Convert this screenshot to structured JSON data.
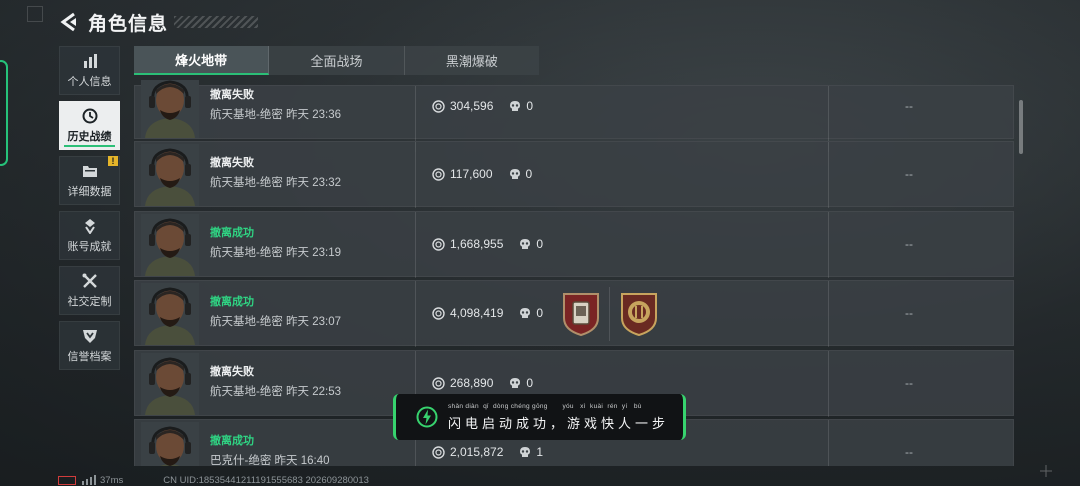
{
  "header": {
    "title": "角色信息"
  },
  "sidebar": {
    "items": [
      {
        "label": "个人信息",
        "icon": "bar-chart-icon",
        "active": false
      },
      {
        "label": "历史战绩",
        "icon": "clock-icon",
        "active": true
      },
      {
        "label": "详细数据",
        "icon": "folder-icon",
        "active": false,
        "badge": "!"
      },
      {
        "label": "账号成就",
        "icon": "medal-icon",
        "active": false
      },
      {
        "label": "社交定制",
        "icon": "tools-icon",
        "active": false
      },
      {
        "label": "信誉档案",
        "icon": "shield-icon",
        "active": false
      }
    ]
  },
  "tabs": [
    {
      "label": "烽火地带",
      "active": true
    },
    {
      "label": "全面战场",
      "active": false
    },
    {
      "label": "黑潮爆破",
      "active": false
    }
  ],
  "matches": [
    {
      "status": "撤离失败",
      "success": false,
      "detail": "航天基地-绝密 昨天 23:36",
      "money": "304,596",
      "kills": "0",
      "extra": "--",
      "medals": []
    },
    {
      "status": "撤离失败",
      "success": false,
      "detail": "航天基地-绝密 昨天 23:32",
      "money": "117,600",
      "kills": "0",
      "extra": "--",
      "medals": []
    },
    {
      "status": "撤离成功",
      "success": true,
      "detail": "航天基地-绝密 昨天 23:19",
      "money": "1,668,955",
      "kills": "0",
      "extra": "--",
      "medals": []
    },
    {
      "status": "撤离成功",
      "success": true,
      "detail": "航天基地-绝密 昨天 23:07",
      "money": "4,098,419",
      "kills": "0",
      "extra": "--",
      "medals": [
        "red-shield-medal-icon",
        "gold-emblem-medal-icon"
      ]
    },
    {
      "status": "撤离失败",
      "success": false,
      "detail": "航天基地-绝密 昨天 22:53",
      "money": "268,890",
      "kills": "0",
      "extra": "--",
      "medals": []
    },
    {
      "status": "撤离成功",
      "success": true,
      "detail": "巴克什-绝密 昨天 16:40",
      "money": "2,015,872",
      "kills": "1",
      "extra": "--",
      "medals": []
    }
  ],
  "toast": {
    "pinyin": "shǎn diàn  qǐ  dòng chéng gōng       yóu   xì  kuài  rén  yí   bù",
    "text": "闪电启动成功，游戏快人一步"
  },
  "footer": {
    "ping": "37ms",
    "uid": "CN UID:18535441211191555683 202609280013"
  },
  "colors": {
    "accent": "#2bbf77",
    "success": "#2fd483",
    "badge": "#e5b52a"
  }
}
